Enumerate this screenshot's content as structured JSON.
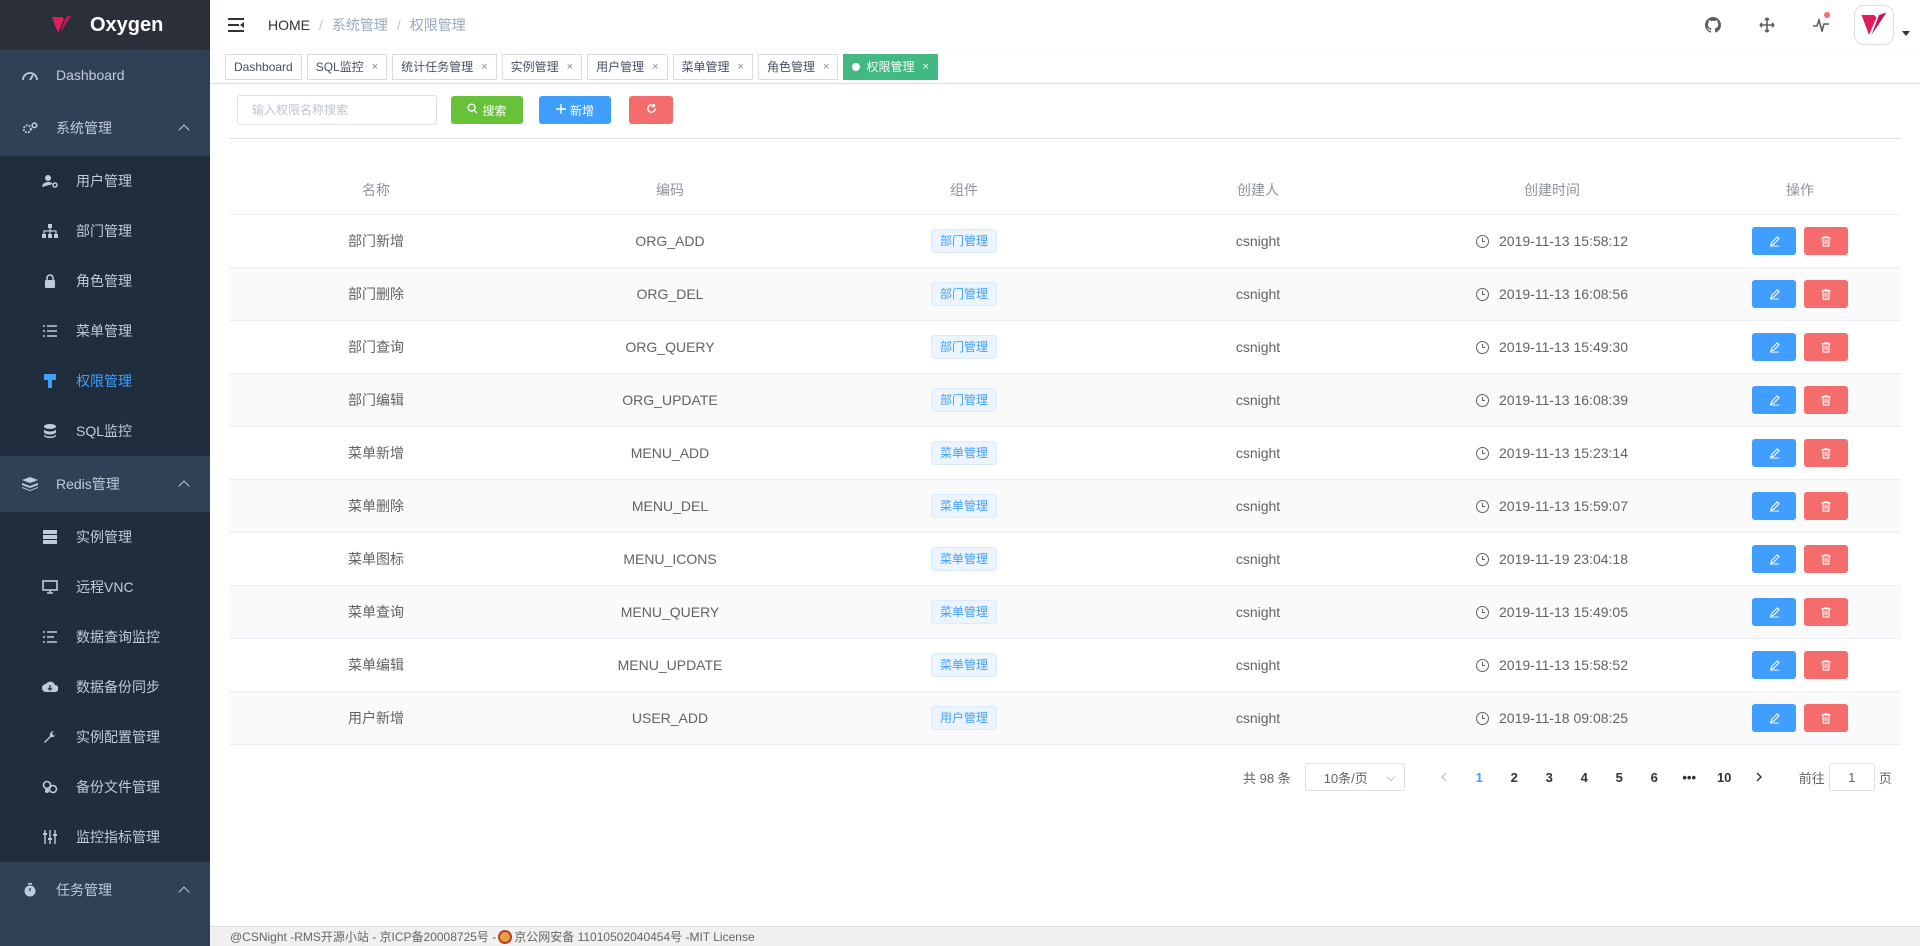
{
  "app": {
    "name": "Oxygen"
  },
  "sidebar": {
    "items": [
      {
        "label": "Dashboard",
        "icon": "dashboard-icon",
        "level": "top"
      },
      {
        "label": "系统管理",
        "icon": "gears-icon",
        "level": "top",
        "open": true
      },
      {
        "label": "用户管理",
        "icon": "user-gear-icon",
        "level": "sub"
      },
      {
        "label": "部门管理",
        "icon": "org-tree-icon",
        "level": "sub"
      },
      {
        "label": "角色管理",
        "icon": "role-icon",
        "level": "sub"
      },
      {
        "label": "菜单管理",
        "icon": "list-icon",
        "level": "sub"
      },
      {
        "label": "权限管理",
        "icon": "permission-icon",
        "level": "sub",
        "active": true
      },
      {
        "label": "SQL监控",
        "icon": "database-icon",
        "level": "sub"
      },
      {
        "label": "Redis管理",
        "icon": "redis-icon",
        "level": "top",
        "open": true
      },
      {
        "label": "实例管理",
        "icon": "server-icon",
        "level": "sub"
      },
      {
        "label": "远程VNC",
        "icon": "monitor-icon",
        "level": "sub"
      },
      {
        "label": "数据查询监控",
        "icon": "query-list-icon",
        "level": "sub"
      },
      {
        "label": "数据备份同步",
        "icon": "cloud-download-icon",
        "level": "sub"
      },
      {
        "label": "实例配置管理",
        "icon": "wrench-icon",
        "level": "sub"
      },
      {
        "label": "备份文件管理",
        "icon": "files-icon",
        "level": "sub"
      },
      {
        "label": "监控指标管理",
        "icon": "sliders-icon",
        "level": "sub"
      },
      {
        "label": "任务管理",
        "icon": "timer-icon",
        "level": "top",
        "open": true
      }
    ]
  },
  "navbar": {
    "breadcrumb": {
      "home": "HOME",
      "section": "系统管理",
      "page": "权限管理"
    },
    "icons": [
      "github-icon",
      "fullscreen-icon",
      "activity-icon"
    ]
  },
  "tags": [
    {
      "label": "Dashboard",
      "closable": false
    },
    {
      "label": "SQL监控",
      "closable": true
    },
    {
      "label": "统计任务管理",
      "closable": true
    },
    {
      "label": "实例管理",
      "closable": true
    },
    {
      "label": "用户管理",
      "closable": true
    },
    {
      "label": "菜单管理",
      "closable": true
    },
    {
      "label": "角色管理",
      "closable": true
    },
    {
      "label": "权限管理",
      "closable": true,
      "active": true
    }
  ],
  "toolbar": {
    "search_placeholder": "输入权限名称搜索",
    "search_label": "搜索",
    "add_label": "新增"
  },
  "table": {
    "columns": [
      "名称",
      "编码",
      "组件",
      "创建人",
      "创建时间",
      "操作"
    ],
    "rows": [
      {
        "name": "部门新增",
        "code": "ORG_ADD",
        "component": "部门管理",
        "creator": "csnight",
        "created": "2019-11-13 15:58:12"
      },
      {
        "name": "部门删除",
        "code": "ORG_DEL",
        "component": "部门管理",
        "creator": "csnight",
        "created": "2019-11-13 16:08:56"
      },
      {
        "name": "部门查询",
        "code": "ORG_QUERY",
        "component": "部门管理",
        "creator": "csnight",
        "created": "2019-11-13 15:49:30"
      },
      {
        "name": "部门编辑",
        "code": "ORG_UPDATE",
        "component": "部门管理",
        "creator": "csnight",
        "created": "2019-11-13 16:08:39"
      },
      {
        "name": "菜单新增",
        "code": "MENU_ADD",
        "component": "菜单管理",
        "creator": "csnight",
        "created": "2019-11-13 15:23:14"
      },
      {
        "name": "菜单删除",
        "code": "MENU_DEL",
        "component": "菜单管理",
        "creator": "csnight",
        "created": "2019-11-13 15:59:07"
      },
      {
        "name": "菜单图标",
        "code": "MENU_ICONS",
        "component": "菜单管理",
        "creator": "csnight",
        "created": "2019-11-19 23:04:18"
      },
      {
        "name": "菜单查询",
        "code": "MENU_QUERY",
        "component": "菜单管理",
        "creator": "csnight",
        "created": "2019-11-13 15:49:05"
      },
      {
        "name": "菜单编辑",
        "code": "MENU_UPDATE",
        "component": "菜单管理",
        "creator": "csnight",
        "created": "2019-11-13 15:58:52"
      },
      {
        "name": "用户新增",
        "code": "USER_ADD",
        "component": "用户管理",
        "creator": "csnight",
        "created": "2019-11-18 09:08:25"
      }
    ]
  },
  "pagination": {
    "total_text": "共 98 条",
    "page_size": "10条/页",
    "pages": [
      "1",
      "2",
      "3",
      "4",
      "5",
      "6",
      "•••",
      "10"
    ],
    "current": "1",
    "goto_prefix": "前往",
    "goto_value": "1",
    "goto_suffix": "页"
  },
  "footer": {
    "text_left": "@CSNight -RMS开源小站 - 京ICP备20008725号 -",
    "text_right": "京公网安备 11010502040454号 -MIT License"
  },
  "colors": {
    "sidebar_bg": "#304156",
    "submenu_bg": "#1f2d3d",
    "logo_bg": "#2b2f3a",
    "primary": "#409eff",
    "success": "#67c23a",
    "danger": "#f56c6c",
    "tag_active": "#42b983"
  }
}
